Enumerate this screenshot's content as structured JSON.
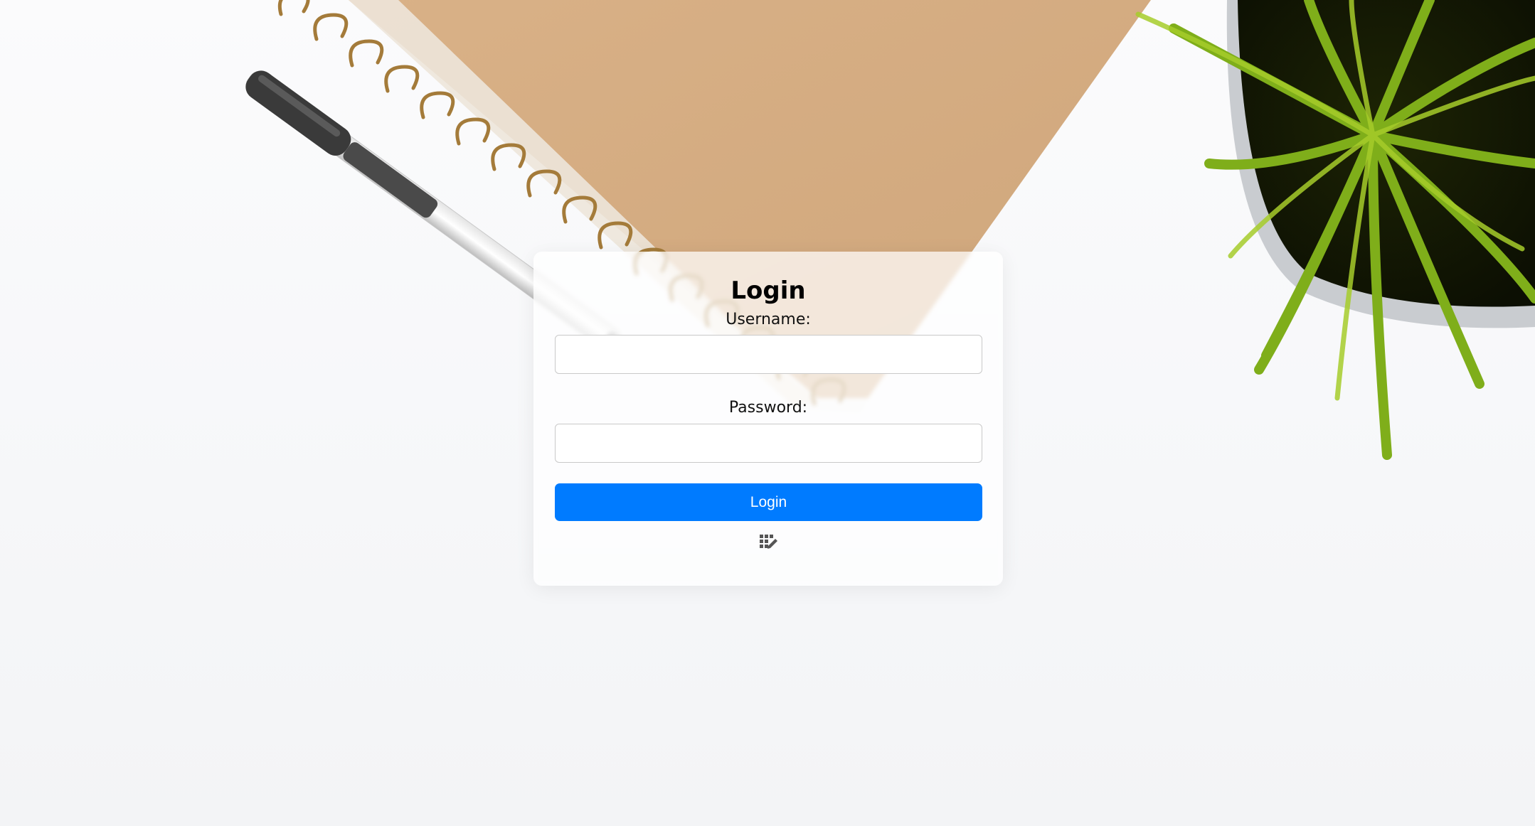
{
  "form": {
    "title": "Login",
    "username_label": "Username:",
    "username_value": "",
    "password_label": "Password:",
    "password_value": "",
    "submit_label": "Login",
    "footer_icon": "keypad-edit-icon"
  },
  "background": {
    "objects": [
      "spiral-notebook",
      "gel-pen",
      "potted-plant"
    ]
  },
  "colors": {
    "button": "#007bff",
    "button_text": "#ffffff",
    "card": "#ffffff",
    "notebook": "#d4ab80",
    "spiral": "#a07938",
    "plant": "#7fae1a"
  }
}
